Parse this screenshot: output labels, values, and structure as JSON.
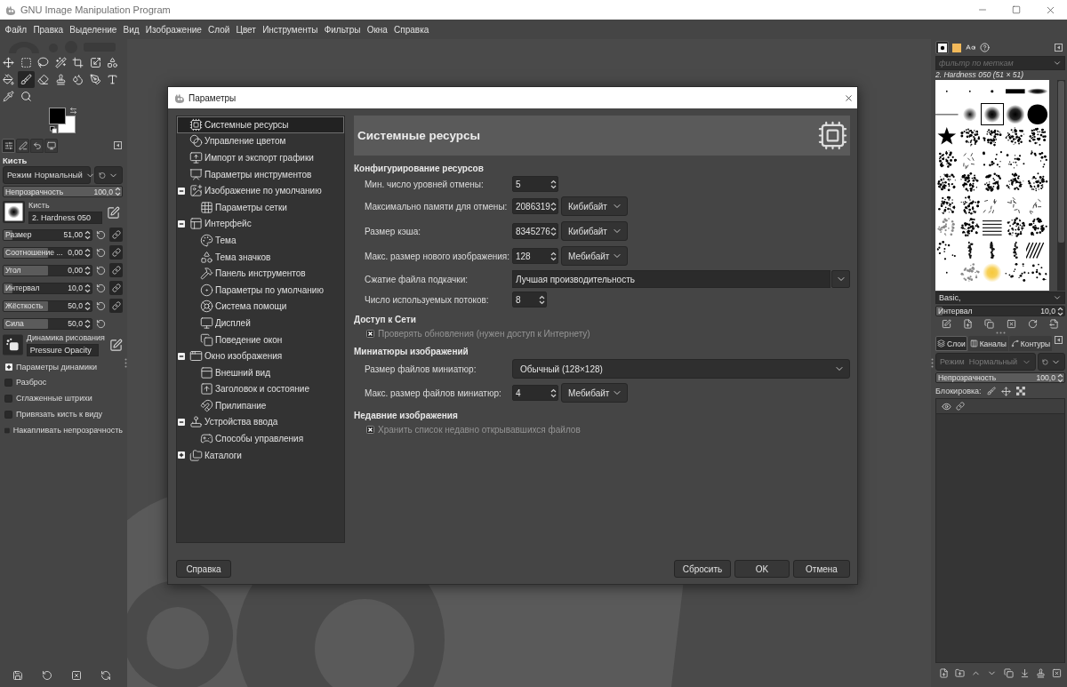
{
  "window": {
    "title": "GNU Image Manipulation Program"
  },
  "menu": [
    "Файл",
    "Правка",
    "Выделение",
    "Вид",
    "Изображение",
    "Слой",
    "Цвет",
    "Инструменты",
    "Фильтры",
    "Окна",
    "Справка"
  ],
  "toolbox": {
    "tools": [
      {
        "selected": false
      },
      {
        "selected": false
      },
      {
        "selected": false
      },
      {
        "selected": false
      },
      {
        "selected": false
      },
      {
        "selected": false
      },
      {
        "selected": false
      },
      {
        "selected": false
      },
      {
        "selected": true
      },
      {
        "selected": false
      },
      {
        "selected": false
      },
      {
        "selected": false
      },
      {
        "selected": false
      },
      {
        "selected": false
      },
      {
        "selected": false
      },
      {
        "selected": false
      }
    ],
    "colors": [
      {
        "kind": "foreground",
        "color": "#000000"
      },
      {
        "kind": "background",
        "color": "#ffffff"
      }
    ]
  },
  "tool_options": {
    "tabs": [
      {
        "kind": "options",
        "selected": true
      },
      {
        "kind": "device",
        "selected": false
      },
      {
        "kind": "undo",
        "selected": false
      },
      {
        "kind": "images",
        "selected": false
      }
    ],
    "title": "Кисть",
    "mode": {
      "label": "Режим",
      "value": "Нормальный"
    },
    "opacity": {
      "label": "Непрозрачность",
      "value": "100,0",
      "level": 1
    },
    "brush": {
      "label": "Кисть",
      "value": "2. Hardness 050"
    },
    "sliders": [
      {
        "kind": "chained",
        "label": "Размер",
        "value": "51,00",
        "level": 0.1
      },
      {
        "kind": "chained",
        "label": "Соотношение ...",
        "value": "0,00",
        "level": 0.5
      },
      {
        "kind": "chained",
        "label": "Угол",
        "value": "0,00",
        "level": 0.5
      },
      {
        "kind": "chained",
        "label": "Интервал",
        "value": "10,0",
        "level": 0.1
      },
      {
        "kind": "chained",
        "label": "Жёсткость",
        "value": "50,0",
        "level": 0.5
      },
      {
        "kind": "plain",
        "label": "Сила",
        "value": "50,0",
        "level": 0.5
      }
    ],
    "dynamics": {
      "label": "Динамика рисования",
      "value": "Pressure Opacity"
    },
    "expander": {
      "label": "Параметры динамики",
      "expanded": false
    },
    "checkboxes": [
      {
        "label": "Разброс",
        "checked": false
      },
      {
        "label": "Сглаженные штрихи",
        "checked": false
      },
      {
        "label": "Привязать кисть к виду",
        "checked": false
      },
      {
        "label": "Накапливать непрозрачность",
        "checked": false
      }
    ]
  },
  "brushes_panel": {
    "tabs": [
      {
        "kind": "brushes",
        "selected": true
      },
      {
        "kind": "patterns",
        "selected": false
      },
      {
        "kind": "fonts",
        "selected": false
      },
      {
        "kind": "help",
        "selected": false
      }
    ],
    "filter": {
      "placeholder": "фильтр по меткам"
    },
    "current": "2. Hardness 050 (51 × 51)",
    "brushes": [
      {
        "kind": "pixel",
        "selected": false
      },
      {
        "kind": "pixel",
        "selected": false
      },
      {
        "kind": "dot",
        "selected": false
      },
      {
        "kind": "bar",
        "selected": false
      },
      {
        "kind": "soft-bar",
        "selected": false
      },
      {
        "kind": "line",
        "selected": false
      },
      {
        "kind": "soft",
        "selected": false
      },
      {
        "kind": "medium",
        "selected": true
      },
      {
        "kind": "soft-big",
        "selected": false
      },
      {
        "kind": "hard",
        "selected": false
      },
      {
        "kind": "star",
        "selected": false
      },
      {
        "kind": "texture",
        "selected": false
      },
      {
        "kind": "texture",
        "selected": false
      },
      {
        "kind": "texture",
        "selected": false
      },
      {
        "kind": "texture",
        "selected": false
      },
      {
        "kind": "texture",
        "selected": false
      },
      {
        "kind": "sticks",
        "selected": false
      },
      {
        "kind": "scatter",
        "selected": false
      },
      {
        "kind": "scatter",
        "selected": false
      },
      {
        "kind": "scatter",
        "selected": false
      },
      {
        "kind": "texture",
        "selected": false
      },
      {
        "kind": "texture",
        "selected": false
      },
      {
        "kind": "texture",
        "selected": false
      },
      {
        "kind": "texture",
        "selected": false
      },
      {
        "kind": "texture",
        "selected": false
      },
      {
        "kind": "texture",
        "selected": false
      },
      {
        "kind": "texture",
        "selected": false
      },
      {
        "kind": "sticks",
        "selected": false
      },
      {
        "kind": "sticks",
        "selected": false
      },
      {
        "kind": "sticks",
        "selected": false
      },
      {
        "kind": "noise",
        "selected": false
      },
      {
        "kind": "texture",
        "selected": false
      },
      {
        "kind": "lines",
        "selected": false
      },
      {
        "kind": "texture",
        "selected": false
      },
      {
        "kind": "texture",
        "selected": false
      },
      {
        "kind": "scatter",
        "selected": false
      },
      {
        "kind": "streak",
        "selected": false
      },
      {
        "kind": "streak",
        "selected": false
      },
      {
        "kind": "streak",
        "selected": false
      },
      {
        "kind": "hatch",
        "selected": false
      },
      {
        "kind": "pixel",
        "selected": false
      },
      {
        "kind": "noise",
        "selected": false
      },
      {
        "kind": "glow",
        "selected": false
      },
      {
        "kind": "scatter",
        "selected": false
      },
      {
        "kind": "scatter",
        "selected": false
      }
    ],
    "tag": "Basic,",
    "spacing": {
      "label": "Интервал",
      "value": "10,0",
      "level": 0.05
    }
  },
  "layers_panel": {
    "tabs": [
      {
        "label": "Слои",
        "selected": true
      },
      {
        "label": "Каналы",
        "selected": false
      },
      {
        "label": "Контуры",
        "selected": false
      }
    ],
    "mode": {
      "label": "Режим",
      "value": "Нормальный",
      "disabled": true
    },
    "opacity": {
      "label": "Непрозрачность",
      "value": "100,0",
      "level": 1
    },
    "lock": {
      "label": "Блокировка:"
    }
  },
  "dialog": {
    "title": "Параметры",
    "tree": [
      {
        "label": "Системные ресурсы",
        "selected": true
      },
      {
        "label": "Управление цветом",
        "selected": false
      },
      {
        "label": "Импорт и экспорт графики",
        "selected": false
      },
      {
        "label": "Параметры инструментов",
        "selected": false
      },
      {
        "label": "Изображение по умолчанию",
        "selected": false,
        "expanded": true,
        "children": [
          {
            "label": "Параметры сетки",
            "selected": false
          }
        ]
      },
      {
        "label": "Интерфейс",
        "selected": false,
        "expanded": true,
        "children": [
          {
            "label": "Тема",
            "selected": false
          },
          {
            "label": "Тема значков",
            "selected": false
          },
          {
            "label": "Панель инструментов",
            "selected": false
          },
          {
            "label": "Параметры по умолчанию",
            "selected": false
          },
          {
            "label": "Система помощи",
            "selected": false
          },
          {
            "label": "Дисплей",
            "selected": false
          },
          {
            "label": "Поведение окон",
            "selected": false
          }
        ]
      },
      {
        "label": "Окно изображения",
        "selected": false,
        "expanded": true,
        "children": [
          {
            "label": "Внешний вид",
            "selected": false
          },
          {
            "label": "Заголовок и состояние",
            "selected": false
          },
          {
            "label": "Прилипание",
            "selected": false
          }
        ]
      },
      {
        "label": "Устройства ввода",
        "selected": false,
        "expanded": true,
        "children": [
          {
            "label": "Способы управления",
            "selected": false
          }
        ]
      },
      {
        "label": "Каталоги",
        "selected": false,
        "expanded": false
      }
    ],
    "page": {
      "title": "Системные ресурсы",
      "sections": [
        {
          "title": "Конфигурирование ресурсов",
          "rows": [
            {
              "kind": "spin",
              "label": "Мин. число уровней отмены:",
              "value": "5"
            },
            {
              "kind": "spin-unit",
              "label": "Максимально памяти для отмены:",
              "value": "2086319",
              "unit": "Кибибайт"
            },
            {
              "kind": "spin-unit",
              "label": "Размер кэша:",
              "value": "8345276",
              "unit": "Кибибайт"
            },
            {
              "kind": "spin-unit",
              "label": "Макс. размер нового изображения:",
              "value": "128",
              "unit": "Мебибайт"
            },
            {
              "kind": "entry-combo",
              "label": "Сжатие файла подкачки:",
              "value": "Лучшая производительность"
            },
            {
              "kind": "small-spin",
              "label": "Число используемых потоков:",
              "value": "8"
            }
          ]
        },
        {
          "title": "Доступ к Сети",
          "rows": [
            {
              "kind": "checkbox",
              "label": "Проверять обновления (нужен доступ к Интернету)",
              "checked": true
            }
          ]
        },
        {
          "title": "Миниатюры изображений",
          "rows": [
            {
              "kind": "combo",
              "label": "Размер файлов миниатюр:",
              "value": "Обычный (128×128)"
            },
            {
              "kind": "spin-unit",
              "label": "Макс. размер файлов миниатюр:",
              "value": "4",
              "unit": "Мебибайт"
            }
          ]
        },
        {
          "title": "Недавние изображения",
          "rows": [
            {
              "kind": "checkbox",
              "label": "Хранить список недавно открывавшихся файлов",
              "checked": true
            }
          ]
        }
      ]
    },
    "help_button": "Справка",
    "buttons": [
      "Сбросить",
      "OK",
      "Отмена"
    ]
  }
}
